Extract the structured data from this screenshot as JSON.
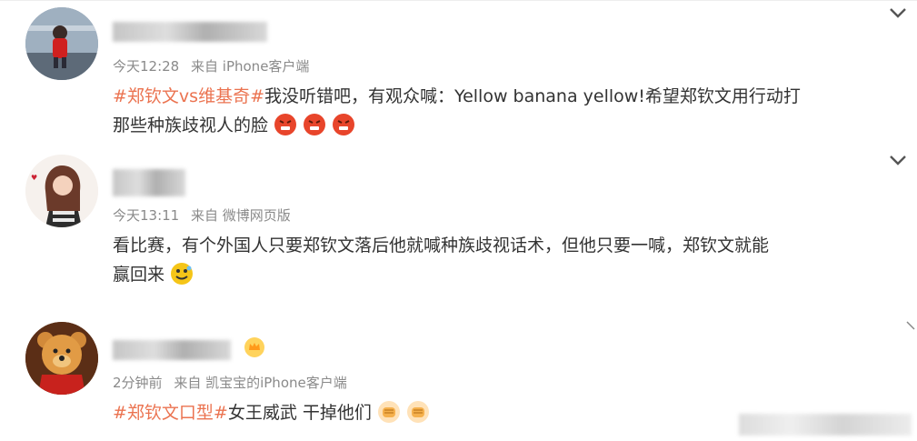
{
  "comments": [
    {
      "time": "今天12:28",
      "source": "来自 iPhone客户端",
      "tag": "#郑钦文vs维基奇#",
      "text_line1": "我没听错吧，有观众喊：Yellow banana yellow!希望郑钦文用行动打",
      "text_line2": "那些种族歧视人的脸"
    },
    {
      "time": "今天13:11",
      "source": "来自 微博网页版",
      "text_line1": "看比赛，有个外国人只要郑钦文落后他就喊种族歧视话术，但他只要一喊，郑钦文就能",
      "text_line2": "赢回来"
    },
    {
      "time": "2分钟前",
      "source": "来自 凯宝宝的iPhone客户端",
      "tag": "#郑钦文口型#",
      "text": "女王威武 干掉他们"
    }
  ],
  "colors": {
    "tag": "#eb7350",
    "meta": "#8a8a8a",
    "text": "#333333"
  },
  "icons": [
    "chevron-down-icon",
    "angry-face-emoji",
    "grimace-face-emoji",
    "fist-emoji"
  ]
}
